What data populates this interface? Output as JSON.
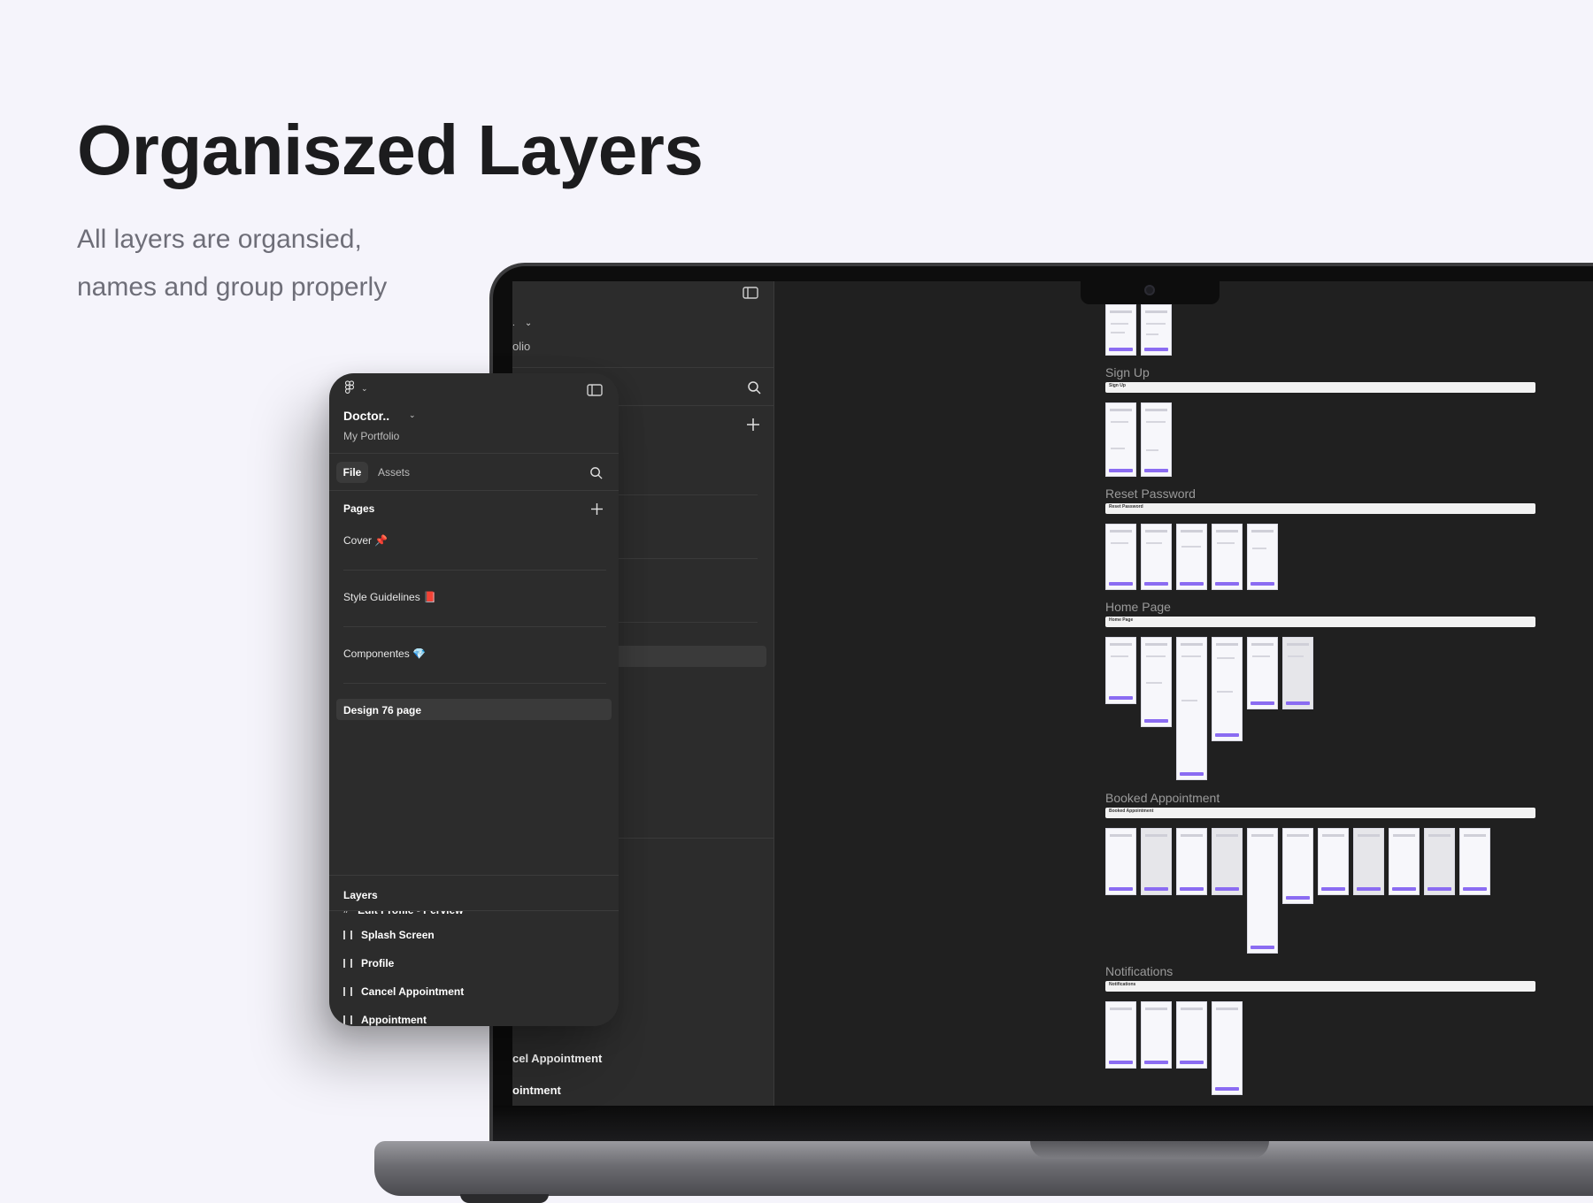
{
  "hero": {
    "title": "Organiszed Layers",
    "subtitle_line1": "All layers are organsied,",
    "subtitle_line2": "names and group properly"
  },
  "phone_panel": {
    "project_name": "Doctor..",
    "project_sub": "My Portfolio",
    "tabs": {
      "file": "File",
      "assets": "Assets"
    },
    "pages_label": "Pages",
    "pages": [
      {
        "label": "Cover 📌"
      },
      {
        "label": "Style Guidelines 📕"
      },
      {
        "label": "Componentes 💎"
      },
      {
        "label": "Design 76 page"
      }
    ],
    "layers_label": "Layers",
    "layers": [
      {
        "label": "Edit Profile - Perview"
      },
      {
        "label": "Splash Screen"
      },
      {
        "label": "Profile"
      },
      {
        "label": "Cancel Appointment"
      },
      {
        "label": "Appointment"
      }
    ]
  },
  "background_panel": {
    "project_sub_fragment": "olio",
    "layer_fragments": [
      {
        "label": "cel Appointment"
      },
      {
        "label": "ointment"
      }
    ]
  },
  "canvas": {
    "sections": [
      {
        "title": "Sign Up",
        "bar_label": "Sign Up"
      },
      {
        "title": "Reset Password",
        "bar_label": "Reset Password"
      },
      {
        "title": "Home Page",
        "bar_label": "Home Page"
      },
      {
        "title": "Booked Appointment",
        "bar_label": "Booked Appointment"
      },
      {
        "title": "Notifications",
        "bar_label": "Notifications"
      }
    ]
  }
}
